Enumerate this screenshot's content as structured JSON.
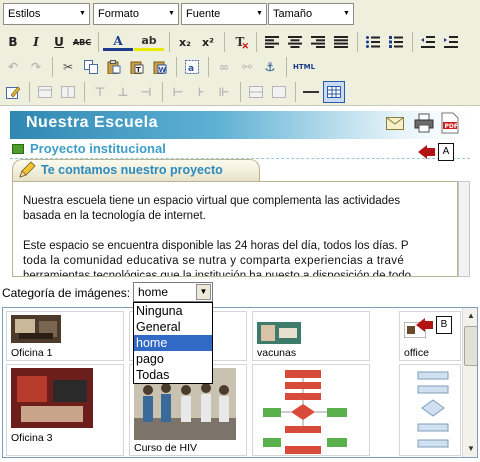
{
  "toolbar": {
    "combos": {
      "styles": "Estilos",
      "format": "Formato",
      "font": "Fuente",
      "size": "Tamaño"
    },
    "text_buttons": {
      "bold": "B",
      "italic": "I",
      "underline": "U",
      "strikethrough": "ABC",
      "text_color": "A",
      "highlight": "ab",
      "subscript": "x₂",
      "superscript": "x²",
      "remove_format": "T",
      "html": "HTML"
    }
  },
  "document": {
    "banner_title": "Nuestra Escuela",
    "subtitle": "Proyecto institucional",
    "section_tab": "Te contamos nuestro proyecto",
    "paragraphs": [
      "Nuestra escuela tiene un espacio virtual que complementa las actividades",
      "basada en la tecnología de internet.",
      "Este espacio se encuentra disponible las 24 horas del día, todos los días. P",
      "toda la comunidad educativa se nutra y comparta experiencias a travé",
      "herramientas tecnológicas que la institución ha puesto a disposición de todo"
    ]
  },
  "callouts": {
    "a": "A",
    "b": "B"
  },
  "image_category": {
    "label": "Categoría de imágenes:",
    "selected": "home",
    "options": [
      "Ninguna",
      "General",
      "home",
      "pago",
      "Todas"
    ]
  },
  "gallery": {
    "items": [
      {
        "caption": "Oficina 1"
      },
      {
        "caption": "vacunas"
      },
      {
        "caption": "office"
      },
      {
        "caption": "Oficina 3"
      },
      {
        "caption": "Curso de HIV"
      },
      {
        "caption": ""
      },
      {
        "caption": ""
      }
    ]
  },
  "colors": {
    "banner_blue": "#2f88b2",
    "subtitle_blue": "#3d9ec8",
    "selection_blue": "#3169c6",
    "callout_red": "#b31313",
    "toolbar_bg": "#efefde"
  }
}
